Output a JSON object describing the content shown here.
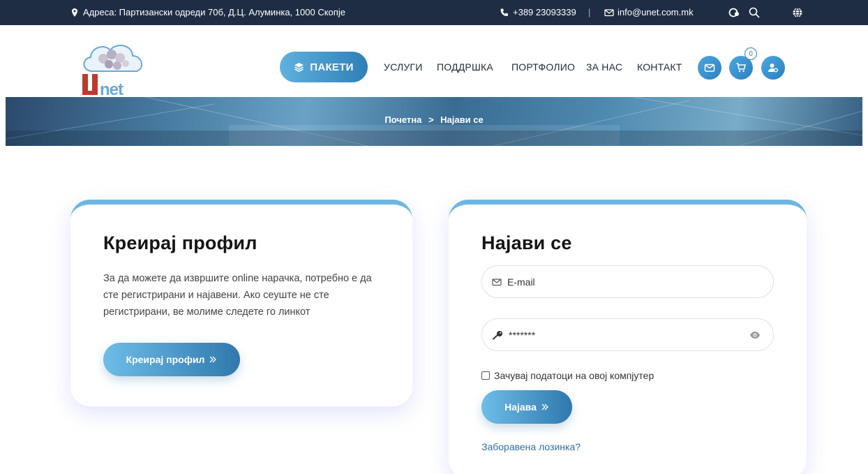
{
  "topbar": {
    "address": "Адреса: Партизански одреди 70б, Д.Ц. Алуминка, 1000 Скопје",
    "phone": "+389 23093339",
    "separator": "|",
    "email": "info@unet.com.mk"
  },
  "header": {
    "nav_pill_label": "ПАКЕТИ",
    "nav_items": [
      "УСЛУГИ",
      "ПОДДРШКА",
      "ПОРТФОЛИО",
      "ЗА НАС",
      "КОНТАКТ"
    ],
    "cart_count": "0"
  },
  "banner": {
    "breadcrumb_home": "Почетна",
    "breadcrumb_sep": ">",
    "breadcrumb_current": "Најави се"
  },
  "register_card": {
    "title": "Креирај профил",
    "description": "За да можете да извршите online нарачка, потребно е да сте регистрирани и најавени. Ако сеуште не сте регистрирани, ве молиме следете го линкот",
    "button_label": "Креирај профил"
  },
  "login_card": {
    "title": "Најави се",
    "email_placeholder": "E-mail",
    "password_value": "*******",
    "remember_label": "Зачувај податоци на овој компјутер",
    "button_label": "Најава",
    "forgot_label": "Заборавена лозинка?"
  },
  "colors": {
    "topbar_bg": "#1f2d44",
    "accent_blue": "#2f7fb7",
    "card_top_border": "#6db6e2"
  }
}
